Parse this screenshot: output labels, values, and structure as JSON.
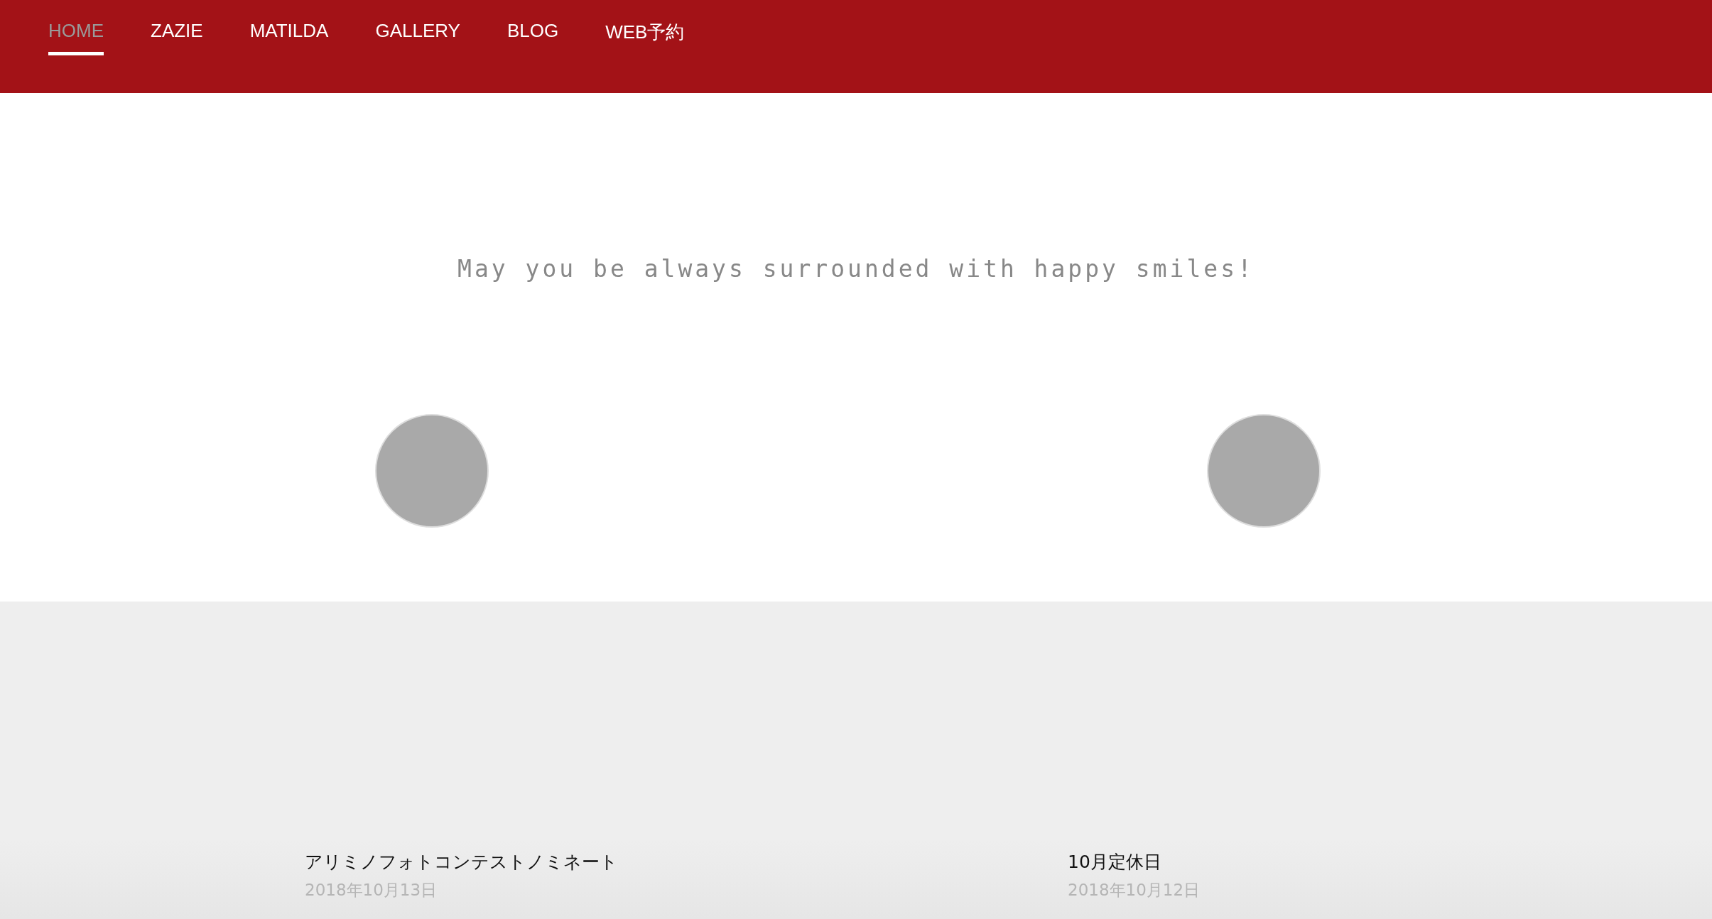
{
  "nav": [
    {
      "label": "HOME",
      "selected": true
    },
    {
      "label": "ZAZIE",
      "selected": false
    },
    {
      "label": "MATILDA",
      "selected": false
    },
    {
      "label": "GALLERY",
      "selected": false
    },
    {
      "label": "BLOG",
      "selected": false
    },
    {
      "label": "WEB予約",
      "selected": false
    }
  ],
  "tagline": "May you be always surrounded with happy smiles!",
  "features": [
    {
      "kind": "placeholder"
    },
    {
      "kind": "placeholder"
    }
  ],
  "posts": [
    {
      "title": "アリミノフォトコンテストノミネート",
      "date": "2018年10月13日"
    },
    {
      "title": "10月定休日",
      "date": "2018年10月12日"
    }
  ]
}
